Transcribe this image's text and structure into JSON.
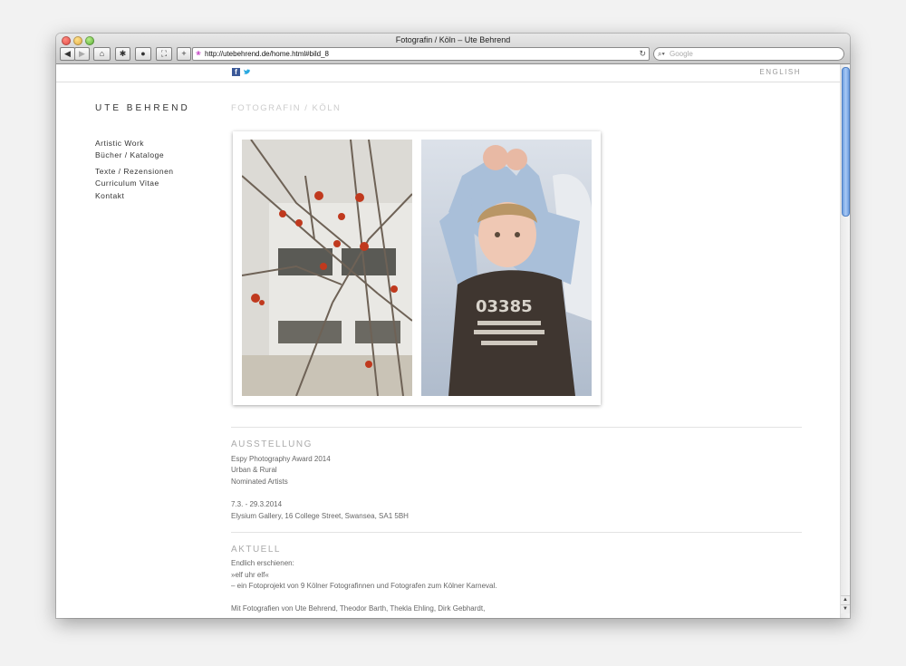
{
  "window": {
    "title": "Fotografin / Köln – Ute Behrend",
    "url": "http://utebehrend.de/home.html#bild_8",
    "search_placeholder": "Google"
  },
  "header": {
    "language_link": "ENGLISH",
    "facebook_label": "f"
  },
  "sidebar": {
    "site_title": "UTE BEHREND",
    "nav": [
      {
        "label": "Artistic Work"
      },
      {
        "label": "Bücher / Kataloge"
      },
      {
        "label": "Texte / Rezensionen"
      },
      {
        "label": "Curriculum Vitae"
      },
      {
        "label": "Kontakt"
      }
    ]
  },
  "main": {
    "tagline": "FOTOGRAFIN / KÖLN",
    "photo_shirt_text": "03385",
    "ausstellung": {
      "title": "AUSSTELLUNG",
      "lines": [
        "Espy Photography Award 2014",
        "Urban & Rural",
        "Nominated Artists",
        "7.3. - 29.3.2014",
        "Elysium Gallery, 16 College Street, Swansea, SA1 5BH"
      ]
    },
    "aktuell": {
      "title": "AKTUELL",
      "lines": [
        "Endlich erschienen:",
        "»elf uhr elf«",
        "– ein Fotoprojekt von 9 Kölner Fotografinnen und Fotografen zum Kölner Karneval.",
        "Mit Fotografien von Ute Behrend, Theodor Barth, Thekla Ehling, Dirk Gebhardt,"
      ]
    }
  }
}
